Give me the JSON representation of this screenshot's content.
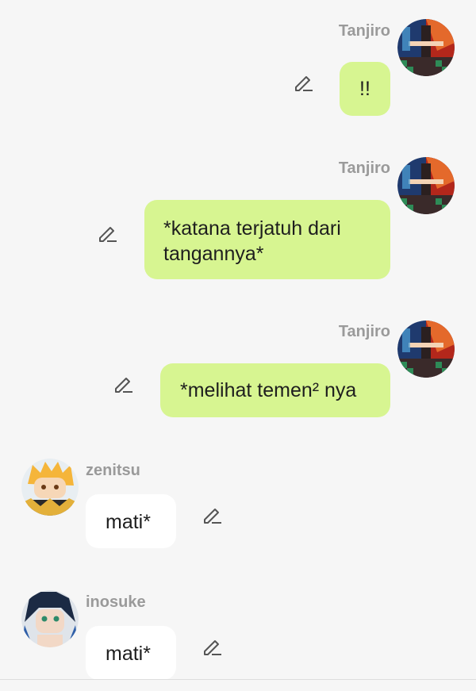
{
  "colors": {
    "background": "#f6f6f6",
    "my_bubble": "#d7f591",
    "other_bubble": "#ffffff",
    "name_text": "#9a9a9a"
  },
  "messages": [
    {
      "sender": "Tanjiro",
      "text": "!!",
      "side": "right",
      "avatar": "tanjiro-avatar"
    },
    {
      "sender": "Tanjiro",
      "text": "*katana terjatuh dari tangannya*",
      "side": "right",
      "avatar": "tanjiro-avatar"
    },
    {
      "sender": "Tanjiro",
      "text": "*melihat temen² nya",
      "side": "right",
      "avatar": "tanjiro-avatar"
    },
    {
      "sender": "zenitsu",
      "text": "mati*",
      "side": "left",
      "avatar": "zenitsu-avatar"
    },
    {
      "sender": "inosuke",
      "text": "mati*",
      "side": "left",
      "avatar": "inosuke-avatar"
    }
  ],
  "icons": {
    "edit": "pencil-icon"
  }
}
